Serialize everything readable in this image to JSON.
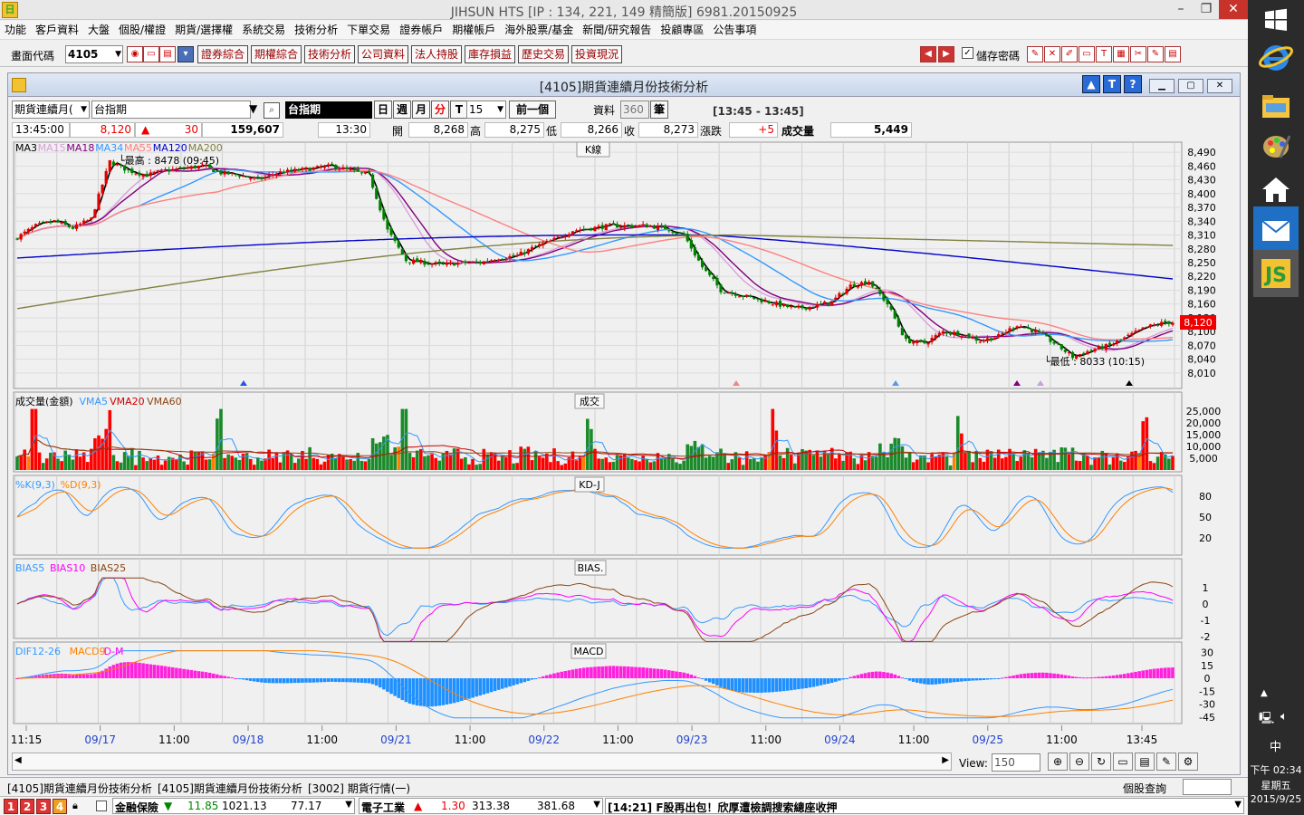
{
  "window": {
    "title": "JIHSUN HTS      [IP : 134, 221, 149 精簡版] 6981.20150925",
    "logo": "日"
  },
  "menu": [
    "功能",
    "客戶資料",
    "大盤",
    "個股/權證",
    "期貨/選擇權",
    "系統交易",
    "技術分析",
    "下單交易",
    "證券帳戶",
    "期權帳戶",
    "海外股票/基金",
    "新聞/研究報告",
    "投顧專區",
    "公告事項"
  ],
  "toolbar": {
    "code_label": "畫面代碼",
    "code_value": "4105",
    "buttons": [
      "證券綜合",
      "期權綜合",
      "技術分析",
      "公司資料",
      "法人持股",
      "庫存損益",
      "歷史交易",
      "投資現況"
    ],
    "save_password_label": "儲存密碼",
    "save_password_checked": true
  },
  "subwindow": {
    "title": "[4105]期貨連續月份技術分析",
    "help_buttons": [
      "▲",
      "T",
      "?"
    ]
  },
  "query": {
    "type_select": "期貨連續月(",
    "product_input": "台指期",
    "product_name": "台指期",
    "periods": [
      "日",
      "週",
      "月",
      "分",
      "T"
    ],
    "active_period": "分",
    "interval_value": "15",
    "prev_button": "前一個",
    "data_label": "資料",
    "data_count": "360",
    "data_unit": "筆",
    "time_range": "[13:45 - 13:45]"
  },
  "quote": {
    "time": "13:45:00",
    "price": "8,120",
    "change": "30",
    "volume_total": "159,607",
    "bar_time": "13:30",
    "open_label": "開",
    "open": "8,268",
    "high_label": "高",
    "high": "8,275",
    "low_label": "低",
    "low": "8,266",
    "close_label": "收",
    "close": "8,273",
    "chg_label": "漲跌",
    "chg": "+5",
    "vol_label": "成交量",
    "vol": "5,449"
  },
  "chart_data": {
    "type": "candlestick",
    "title": "K線",
    "legend": [
      {
        "name": "MA3",
        "color": "#000000"
      },
      {
        "name": "MA15",
        "color": "#d8a0d8"
      },
      {
        "name": "MA18",
        "color": "#800080"
      },
      {
        "name": "MA34",
        "color": "#3399ff"
      },
      {
        "name": "MA55",
        "color": "#ff8080"
      },
      {
        "name": "MA120",
        "color": "#0000cc"
      },
      {
        "name": "MA200",
        "color": "#808040"
      }
    ],
    "y_ticks": [
      8490,
      8460,
      8430,
      8400,
      8370,
      8340,
      8310,
      8280,
      8250,
      8220,
      8190,
      8160,
      8130,
      8100,
      8070,
      8040,
      8010
    ],
    "y_range": [
      8000,
      8500
    ],
    "annotations": [
      "最高 : 8478 (09:45)",
      "最低 : 8033 (10:15)"
    ],
    "last_price_tag": "8,120",
    "x_labels": [
      {
        "label": "11:15",
        "blue": false
      },
      {
        "label": "09/17",
        "blue": true
      },
      {
        "label": "11:00",
        "blue": false
      },
      {
        "label": "09/18",
        "blue": true
      },
      {
        "label": "11:00",
        "blue": false
      },
      {
        "label": "09/21",
        "blue": true
      },
      {
        "label": "11:00",
        "blue": false
      },
      {
        "label": "09/22",
        "blue": true
      },
      {
        "label": "11:00",
        "blue": false
      },
      {
        "label": "09/23",
        "blue": true
      },
      {
        "label": "11:00",
        "blue": false
      },
      {
        "label": "09/24",
        "blue": true
      },
      {
        "label": "11:00",
        "blue": false
      },
      {
        "label": "09/25",
        "blue": true
      },
      {
        "label": "11:00",
        "blue": false
      },
      {
        "label": "13:45",
        "blue": false
      }
    ],
    "close_anchors": [
      [
        0,
        8305
      ],
      [
        5,
        8330
      ],
      [
        10,
        8340
      ],
      [
        15,
        8325
      ],
      [
        20,
        8345
      ],
      [
        25,
        8470
      ],
      [
        30,
        8450
      ],
      [
        35,
        8440
      ],
      [
        40,
        8450
      ],
      [
        45,
        8455
      ],
      [
        50,
        8460
      ],
      [
        55,
        8445
      ],
      [
        60,
        8440
      ],
      [
        65,
        8430
      ],
      [
        70,
        8445
      ],
      [
        75,
        8450
      ],
      [
        80,
        8455
      ],
      [
        85,
        8460
      ],
      [
        90,
        8450
      ],
      [
        95,
        8440
      ],
      [
        100,
        8320
      ],
      [
        105,
        8255
      ],
      [
        110,
        8250
      ],
      [
        115,
        8245
      ],
      [
        120,
        8250
      ],
      [
        125,
        8250
      ],
      [
        130,
        8260
      ],
      [
        135,
        8265
      ],
      [
        140,
        8285
      ],
      [
        145,
        8300
      ],
      [
        150,
        8320
      ],
      [
        155,
        8325
      ],
      [
        160,
        8330
      ],
      [
        165,
        8330
      ],
      [
        170,
        8330
      ],
      [
        175,
        8325
      ],
      [
        180,
        8310
      ],
      [
        185,
        8240
      ],
      [
        190,
        8190
      ],
      [
        195,
        8180
      ],
      [
        200,
        8170
      ],
      [
        205,
        8160
      ],
      [
        210,
        8150
      ],
      [
        215,
        8155
      ],
      [
        220,
        8165
      ],
      [
        225,
        8200
      ],
      [
        230,
        8210
      ],
      [
        235,
        8160
      ],
      [
        240,
        8080
      ],
      [
        245,
        8075
      ],
      [
        250,
        8100
      ],
      [
        255,
        8095
      ],
      [
        260,
        8080
      ],
      [
        265,
        8090
      ],
      [
        270,
        8115
      ],
      [
        275,
        8100
      ],
      [
        280,
        8075
      ],
      [
        285,
        8045
      ],
      [
        290,
        8060
      ],
      [
        295,
        8070
      ],
      [
        300,
        8090
      ],
      [
        305,
        8110
      ],
      [
        310,
        8120
      ],
      [
        312,
        8120
      ]
    ],
    "ma_end_values": {
      "MA3": 8120,
      "MA15": 8095,
      "MA18": 8095,
      "MA34": 8095,
      "MA55": 8120,
      "MA120": 8235,
      "MA200": 8275
    }
  },
  "volume_panel": {
    "title": "成交",
    "legend": [
      {
        "name": "成交量(金額)",
        "color": "#000000"
      },
      {
        "name": "VMA5",
        "color": "#3399ff"
      },
      {
        "name": "VMA20",
        "color": "#cc0000"
      },
      {
        "name": "VMA60",
        "color": "#8b4513"
      }
    ],
    "y_ticks": [
      "25,000",
      "20,000",
      "15,000",
      "10,000",
      "5,000"
    ],
    "y_range": [
      0,
      27000
    ]
  },
  "kd_panel": {
    "title": "KD-J",
    "legend": [
      {
        "name": "%K(9,3)",
        "color": "#3399ff"
      },
      {
        "name": "%D(9,3)",
        "color": "#ff8000"
      }
    ],
    "y_ticks": [
      "80",
      "50",
      "20"
    ]
  },
  "bias_panel": {
    "title": "BIAS.",
    "legend": [
      {
        "name": "BIAS5",
        "color": "#3399ff"
      },
      {
        "name": "BIAS10",
        "color": "#ff00ff"
      },
      {
        "name": "BIAS25",
        "color": "#8b4513"
      }
    ],
    "y_ticks": [
      "1",
      "0",
      "-1",
      "-2"
    ]
  },
  "macd_panel": {
    "title": "MACD",
    "legend": [
      {
        "name": "DIF12-26",
        "color": "#3399ff"
      },
      {
        "name": "MACD9",
        "color": "#ff8000"
      },
      {
        "name": "D-M",
        "color": "#ff00ff"
      }
    ],
    "y_ticks": [
      "30",
      "15",
      "0",
      "-15",
      "-30",
      "-45"
    ]
  },
  "scroll": {
    "view_label": "View:",
    "view_value": "150"
  },
  "tabs": [
    "[4105]期貨連續月份技術分析",
    "[4105]期貨連續月份技術分析",
    "[3002] 期貨行情(一)"
  ],
  "tabs_right": "個股查詢",
  "status": {
    "page_buttons": [
      "1",
      "2",
      "3",
      "4"
    ],
    "sector1": "金融保險",
    "sector1_change": "11.85",
    "sector1_index": "1021.13",
    "sector1_volume": "77.17",
    "sector2": "電子工業",
    "sector2_change": "1.30",
    "sector2_index": "313.38",
    "sector2_volume": "381.68",
    "news": "[14:21] F股再出包！欣厚遭檢調搜索總座收押"
  },
  "os_taskbar": {
    "input_method": "中",
    "time": "下午 02:34",
    "weekday": "星期五",
    "date": "2015/9/25"
  }
}
